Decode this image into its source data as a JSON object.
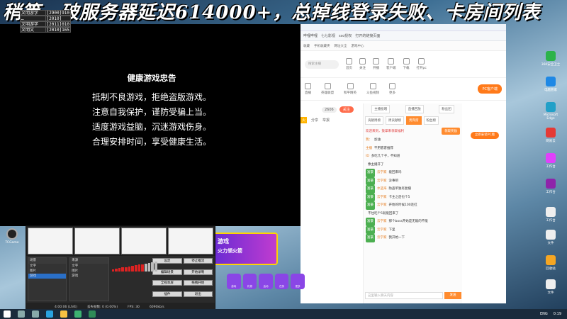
{
  "banner": {
    "title": "稍等，破服务器延迟614000+，总掉线登录失败、卡房间列表"
  },
  "infobox": [
    [
      "文明游学",
      "[2900]910"
    ],
    [
      "…",
      "[2010]"
    ],
    [
      "文明游学",
      "[2011]010"
    ],
    [
      "文明文",
      "[2010]165"
    ]
  ],
  "notice": {
    "title": "健康游戏忠告",
    "lines": [
      "抵制不良游戏，拒绝盗版游戏。",
      "注意自我保护，谨防受骗上当。",
      "适度游戏益脑，沉迷游戏伤身。",
      "合理安排时间，享受健康生活。"
    ]
  },
  "browser": {
    "tabs": [
      "哔哩哔哩",
      "七七影视",
      "sso授权",
      "打开的链接页面"
    ],
    "bookmarks": [
      "收藏",
      "手机收藏夹",
      "网址大全",
      "游戏中心",
      "百度",
      "翻译"
    ],
    "search_placeholder": "搜索主播",
    "nav": [
      "首页",
      "关注",
      "开播",
      "客户端",
      "下载",
      "打开pc"
    ],
    "cats": [
      "直播",
      "英雄联盟",
      "和平精英",
      "斗鱼视频",
      "更多"
    ],
    "pc_button": "PC客户端",
    "pc_sub": "立即安装PC版",
    "follow": "关注",
    "fans": "2606",
    "fire": "火",
    "share": "分享",
    "report": "举报",
    "chat_tabs": [
      "主播投喂",
      "直播回放",
      "粉丝团"
    ],
    "chat_subtabs": [
      "贡献周榜",
      "周贡献榜",
      "贵宾席",
      "粉丝榜"
    ],
    "chat_notice": "欢迎来到，鼓掌来领取福利",
    "chat_btn": "领取奖励",
    "messages": [
      {
        "lv": "",
        "name": "我：",
        "text": "加油"
      },
      {
        "lv": "",
        "name": "主播",
        "text": "不用客客推荐"
      },
      {
        "lv": "",
        "name": "ID",
        "text": "多吃几个子，不知道"
      },
      {
        "lv": "",
        "name": "",
        "text": "像主播开了"
      },
      {
        "lv": "富豪",
        "name": "云学家",
        "text": "能回来吗"
      },
      {
        "lv": "富豪",
        "name": "云学家",
        "text": "没事吧"
      },
      {
        "lv": "富豪",
        "name": "水蓝海",
        "text": "防盗单独有复播"
      },
      {
        "lv": "富豪",
        "name": "云学家",
        "text": "卡主之后也个5"
      },
      {
        "lv": "富豪",
        "name": "云学家",
        "text": "开始的时候100连扛"
      },
      {
        "lv": "",
        "name": "",
        "text": "不住吃个5就能回来了"
      },
      {
        "lv": "富豪",
        "name": "云学家",
        "text": "那个boss开始是无敌的不能"
      },
      {
        "lv": "富豪",
        "name": "云学家",
        "text": "下里"
      },
      {
        "lv": "富豪",
        "name": "云学家",
        "text": "我开始一下"
      }
    ],
    "chat_input_placeholder": "这里输入聊天内容",
    "send_btn": "发送"
  },
  "obs": {
    "scene_header": "场景",
    "scenes": [
      "文字",
      "图片",
      "游戏"
    ],
    "source_header": "来源",
    "sources": [
      "文字",
      "图片",
      "游戏"
    ],
    "buttons": [
      "设定",
      "停止推流",
      "编辑场景",
      "开始录制",
      "全视本屏",
      "拖拽开始",
      "插件",
      "退出"
    ],
    "status": [
      "4:00:06 (LIVE)",
      "丢失帧数: 0 (0.00%)",
      "FPS: 30",
      "6090kb/s"
    ]
  },
  "obs_icon_label": "TCGame",
  "ad": {
    "title": "游戏",
    "subtitle": "火力领火箭",
    "icons": [
      "游戏",
      "礼物",
      "活动",
      "任务",
      "更多",
      "商城"
    ]
  },
  "desktop": {
    "icons": [
      "360安全卫士",
      "电脑管家",
      "Microsoft Edge",
      "网易云",
      "工作台",
      "文件",
      "回收站"
    ],
    "char_label": "名人"
  },
  "taskbar": {
    "lang": "ENG",
    "time": "0:19"
  }
}
